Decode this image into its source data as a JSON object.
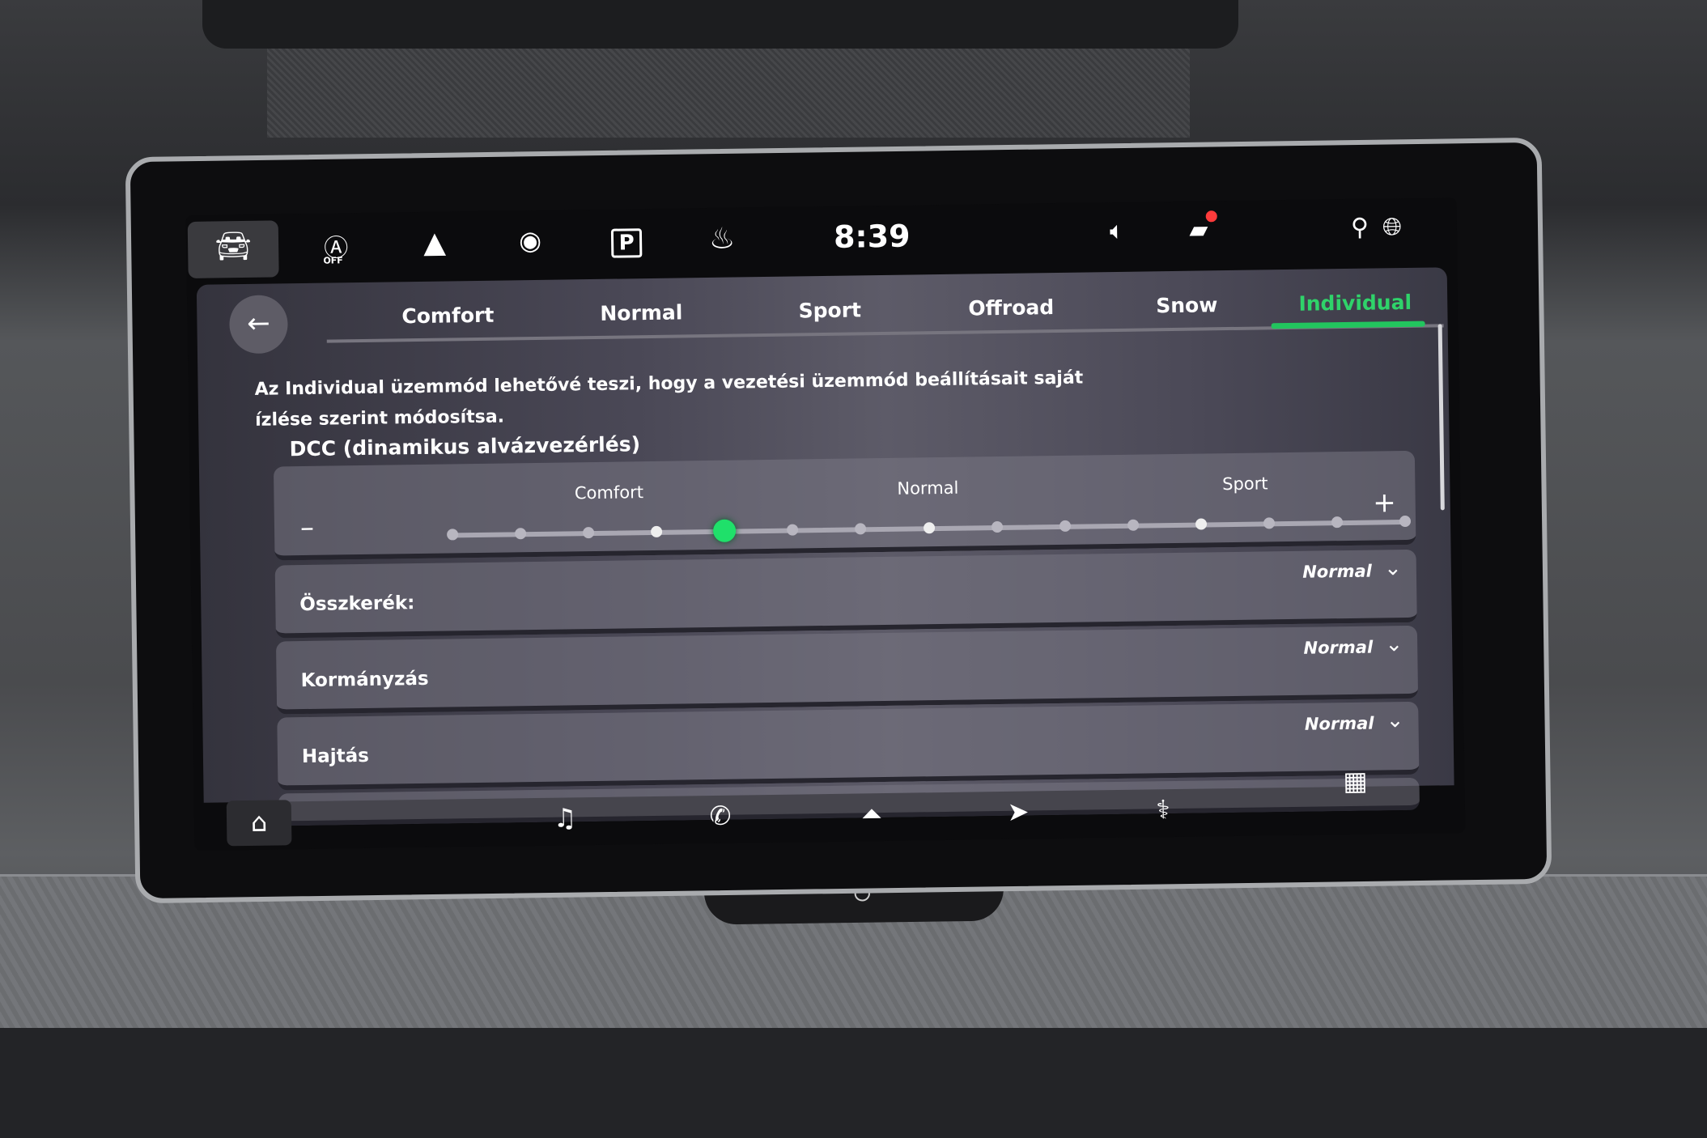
{
  "status_bar": {
    "time": "8:39",
    "icons": [
      "car-icon",
      "auto-hold-off-icon",
      "mountain-icon",
      "driver-assist-icon",
      "parking-icon",
      "heated-seat-icon",
      "volume-icon",
      "notification-icon",
      "profile-location-icon",
      "globe-icon"
    ],
    "auto_off_label": "OFF",
    "parking_label": "P",
    "notification_badge_color": "#ff3b3b"
  },
  "modes": {
    "tabs": [
      {
        "label": "Comfort"
      },
      {
        "label": "Normal"
      },
      {
        "label": "Sport"
      },
      {
        "label": "Offroad"
      },
      {
        "label": "Snow"
      },
      {
        "label": "Individual",
        "active": true
      }
    ],
    "accent_color": "#22c55e"
  },
  "description": "Az Individual üzemmód lehetővé teszi, hogy a vezetési üzemmód beállításait saját ízlése szerint módosítsa.",
  "dcc": {
    "title": "DCC (dinamikus alvázvezérlés)",
    "minus": "–",
    "plus": "+",
    "labels": {
      "comfort": "Comfort",
      "normal": "Normal",
      "sport": "Sport"
    },
    "steps": 15,
    "selected_step": 5
  },
  "settings": [
    {
      "label": "Összkerék:",
      "value": "Normal"
    },
    {
      "label": "Kormányzás",
      "value": "Normal"
    },
    {
      "label": "Hajtás",
      "value": "Normal"
    }
  ],
  "bottom_nav": [
    "home-icon",
    "music-icon",
    "phone-icon",
    "android-auto-icon",
    "navigation-icon",
    "seat-icon",
    "apps-grid-icon"
  ]
}
